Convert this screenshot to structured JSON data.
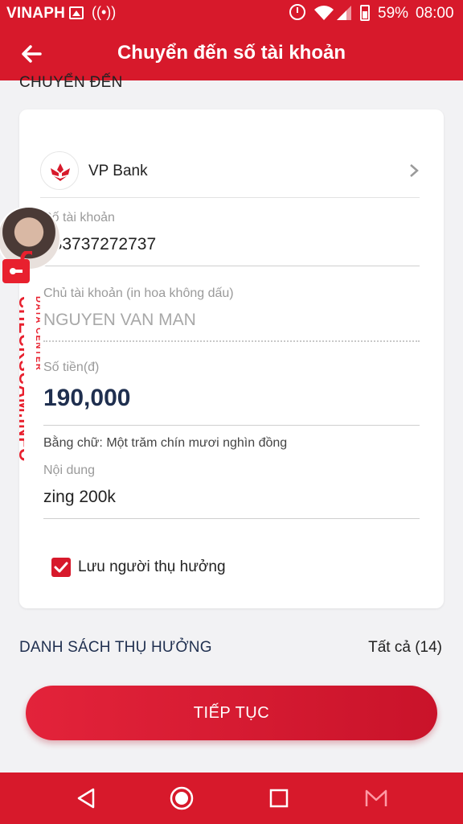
{
  "status_bar": {
    "carrier": "VINAPH",
    "battery_percent": "59%",
    "time": "08:00"
  },
  "app_bar": {
    "title": "Chuyển đến số tài khoản"
  },
  "section_label": "CHUYỂN ĐẾN",
  "bank": {
    "name": "VP Bank"
  },
  "fields": {
    "account": {
      "label": "Số tài khoản",
      "value": "333737272737"
    },
    "owner": {
      "label": "Chủ tài khoản (in hoa không dấu)",
      "value": "NGUYEN VAN MAN"
    },
    "amount": {
      "label": "Số tiền(đ)",
      "value": "190,000"
    },
    "amount_words": "Bằng chữ: Một trăm chín mươi nghìn đồng",
    "content": {
      "label": "Nội dung",
      "value": "zing 200k"
    }
  },
  "save_beneficiary": {
    "label": "Lưu người thụ hưởng",
    "checked": true
  },
  "beneficiary_list": {
    "label": "DANH SÁCH THỤ HƯỞNG",
    "count_label": "Tất cả (14)"
  },
  "continue_button": "TIẾP TỤC",
  "watermark": {
    "main": "CHECKSCAM.INFO",
    "sub": "DATA CENTER"
  },
  "colors": {
    "brand_red": "#d7192b",
    "navy": "#1f2f4f"
  }
}
